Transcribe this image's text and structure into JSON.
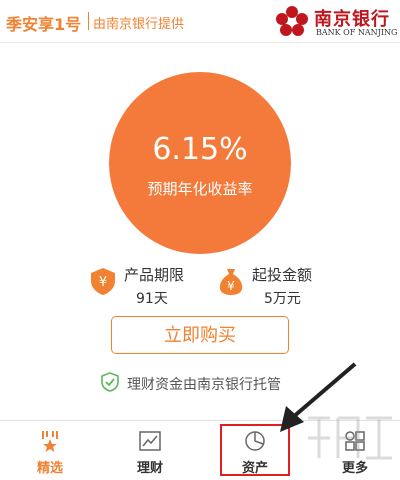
{
  "header": {
    "product_name": "季安享1号",
    "provider": "由南京银行提供",
    "bank_name_cn": "南京银行",
    "bank_name_en": "BANK OF NANJING"
  },
  "rate": {
    "value": "6.15%",
    "label": "预期年化收益率"
  },
  "info": {
    "term_label": "产品期限",
    "term_value": "91天",
    "min_label": "起投金额",
    "min_value": "5万元"
  },
  "buy_button_label": "立即购买",
  "trust_note": "理财资金由南京银行托管",
  "tabs": [
    {
      "label": "精选",
      "icon": "medal-icon",
      "active": true
    },
    {
      "label": "理财",
      "icon": "chart-icon",
      "active": false
    },
    {
      "label": "资产",
      "icon": "pie-chart-icon",
      "active": false
    },
    {
      "label": "更多",
      "icon": "grid-icon",
      "active": false
    }
  ],
  "colors": {
    "accent": "#f08232",
    "rate_circle": "#f37a3a",
    "bank_red": "#c0171f",
    "highlight": "#e02020",
    "trust_green": "#5cb85c"
  }
}
